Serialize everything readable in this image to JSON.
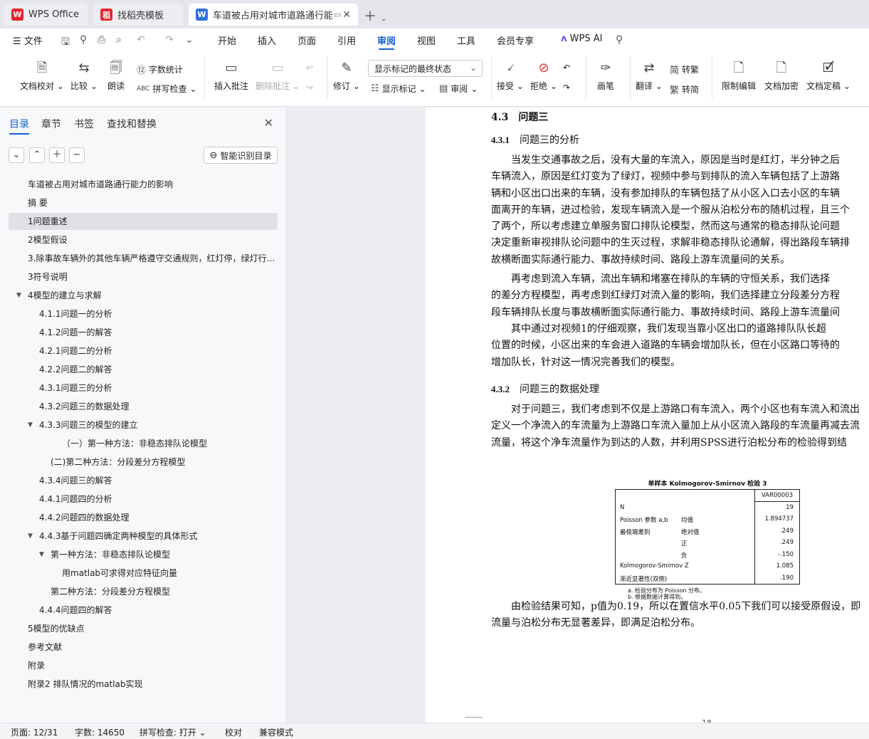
{
  "tabs": [
    {
      "label": "WPS Office",
      "logo": "W",
      "logo_color": "#e5232d"
    },
    {
      "label": "找稻壳模板",
      "logo": "稻",
      "logo_color": "#e5232d"
    },
    {
      "label": "车道被占用对城市道路通行能力",
      "logo": "W",
      "logo_color": "#2f6fe0"
    }
  ],
  "menu": {
    "file": "文件",
    "items": [
      "开始",
      "插入",
      "页面",
      "引用",
      "审阅",
      "视图",
      "工具",
      "会员专享"
    ],
    "active": "审阅",
    "ai": "WPS AI"
  },
  "ribbon": {
    "proof": "文档校对",
    "compare": "比较",
    "read": "朗读",
    "wordcount": "字数统计",
    "spellcheck": "拼写检查",
    "insert_comment": "插入批注",
    "delete_comment": "删除批注",
    "revise": "修订",
    "markup_state": "显示标记的最终状态",
    "show_markup": "显示标记",
    "review": "审阅",
    "accept": "接受",
    "reject": "拒绝",
    "pen": "画笔",
    "translate": "翻译",
    "to_traditional": "转繁",
    "to_simplified": "转简",
    "restrict_edit": "限制编辑",
    "encrypt": "文档加密",
    "finalize": "文档定稿"
  },
  "panel": {
    "tabs": [
      "目录",
      "章节",
      "书签",
      "查找和替换"
    ],
    "active_tab": "目录",
    "smart_btn": "智能识别目录",
    "toc": [
      {
        "label": "车道被占用对城市道路通行能力的影响",
        "level": 1
      },
      {
        "label": "摘 要",
        "level": 1
      },
      {
        "label": "1问题重述",
        "level": 1,
        "selected": true
      },
      {
        "label": "2模型假设",
        "level": 1
      },
      {
        "label": "3.除事故车辆外的其他车辆严格遵守交通规则，红灯停，绿灯行…",
        "level": 1
      },
      {
        "label": "3符号说明",
        "level": 1
      },
      {
        "label": "4模型的建立与求解",
        "level": 1,
        "expanded": true
      },
      {
        "label": "4.1.1问题一的分析",
        "level": 2
      },
      {
        "label": "4.1.2问题一的解答",
        "level": 2
      },
      {
        "label": "4.2.1问题二的分析",
        "level": 2
      },
      {
        "label": "4.2.2问题二的解答",
        "level": 2
      },
      {
        "label": "4.3.1问题三的分析",
        "level": 2
      },
      {
        "label": "4.3.2问题三的数据处理",
        "level": 2
      },
      {
        "label": "4.3.3问题三的模型的建立",
        "level": 2,
        "expanded": true
      },
      {
        "label": "（一）第一种方法：非稳态排队论模型",
        "level": 4
      },
      {
        "label": "(二)第二种方法：分段差分方程模型",
        "level": 3
      },
      {
        "label": "4.3.4问题三的解答",
        "level": 2
      },
      {
        "label": "4.4.1问题四的分析",
        "level": 2
      },
      {
        "label": "4.4.2问题四的数据处理",
        "level": 2
      },
      {
        "label": "4.4.3基于问题四确定两种模型的具体形式",
        "level": 2,
        "expanded": true
      },
      {
        "label": "第一种方法：非稳态排队论模型",
        "level": 3,
        "expanded": true
      },
      {
        "label": "用matlab可求得对应特征向量",
        "level": 4
      },
      {
        "label": "第二种方法：分段差分方程模型",
        "level": 3
      },
      {
        "label": "4.4.4问题四的解答",
        "level": 2
      },
      {
        "label": "5模型的优缺点",
        "level": 1
      },
      {
        "label": "参考文献",
        "level": 1
      },
      {
        "label": "附录",
        "level": 1
      },
      {
        "label": "附录2 排队情况的matlab实现",
        "level": 1
      }
    ]
  },
  "doc": {
    "h_43": "4.3　问题三",
    "h_431_num": "4.3.1",
    "h_431": "问题三的分析",
    "p1": [
      "　　当发生交通事故之后，没有大量的车流入，原因是当时是红灯，半分钟之后",
      "车辆流入，原因是红灯变为了绿灯，视频中参与到排队的流入车辆包括了上游路",
      "辆和小区出口出来的车辆，没有参加排队的车辆包括了从小区入口去小区的车辆",
      "面离开的车辆，进过检验，发现车辆流入是一个服从泊松分布的随机过程，且三个",
      "了两个，所以考虑建立单服务窗口排队论模型，然而这与通常的稳态排队论问题",
      "决定重新审视排队论问题中的生灭过程，求解非稳态排队论通解，得出路段车辆排",
      "故横断面实际通行能力、事故持续时间、路段上游车流量间的关系。"
    ],
    "p2": [
      "　　再考虑到流入车辆，流出车辆和堵塞在排队的车辆的守恒关系，我们选择",
      "的差分方程模型，再考虑到红绿灯对流入量的影响，我们选择建立分段差分方程",
      "段车辆排队长度与事故横断面实际通行能力、事故持续时间、路段上游车流量间"
    ],
    "p3": [
      "　　其中通过对视频1的仔细观察，我们发现当靠小区出口的道路排队队长超",
      "位置的时候，小区出来的车会进入道路的车辆会增加队长，但在小区路口等待的",
      "增加队长，针对这一情况完善我们的模型。"
    ],
    "h_432_num": "4.3.2",
    "h_432": "问题三的数据处理",
    "p4": [
      "　　对于问题三，我们考虑到不仅是上游路口有车流入，两个小区也有车流入和流出",
      "定义一个净流入的车流量为上游路口车流入量加上从小区流入路段的车流量再减去流",
      "流量，将这个净车流量作为到达的人数，并利用SPSS进行泊松分布的检验得到结"
    ],
    "table": {
      "title": "单样本 Kolmogorov-Smirnov 检验 3",
      "col": "VAR00003",
      "rows": [
        {
          "a": "N",
          "b": "",
          "v": "19"
        },
        {
          "a": "Poisson 参数 a,b",
          "b": "均值",
          "v": "1.894737"
        },
        {
          "a": "最极端差别",
          "b": "绝对值",
          "v": ".249"
        },
        {
          "a": "",
          "b": "正",
          "v": ".249"
        },
        {
          "a": "",
          "b": "负",
          "v": "-.150"
        },
        {
          "a": "Kolmogorov-Smirnov Z",
          "b": "",
          "v": "1.085"
        },
        {
          "a": "渐近显著性(双侧)",
          "b": "",
          "v": ".190"
        }
      ],
      "note_a": "a. 检验分布为 Poisson 分布。",
      "note_b": "b. 根据数据计算得到。"
    },
    "p5": [
      "　　由检验结果可知，p值为0.19，所以在置信水平0.05下我们可以接受原假设，即",
      "流量与泊松分布无显著差异，即满足泊松分布。"
    ],
    "page_num": "18"
  },
  "status": {
    "page": "页面: 12/31",
    "words": "字数: 14650",
    "spell": "拼写检查: 打开",
    "proof": "校对",
    "compat": "兼容模式"
  }
}
